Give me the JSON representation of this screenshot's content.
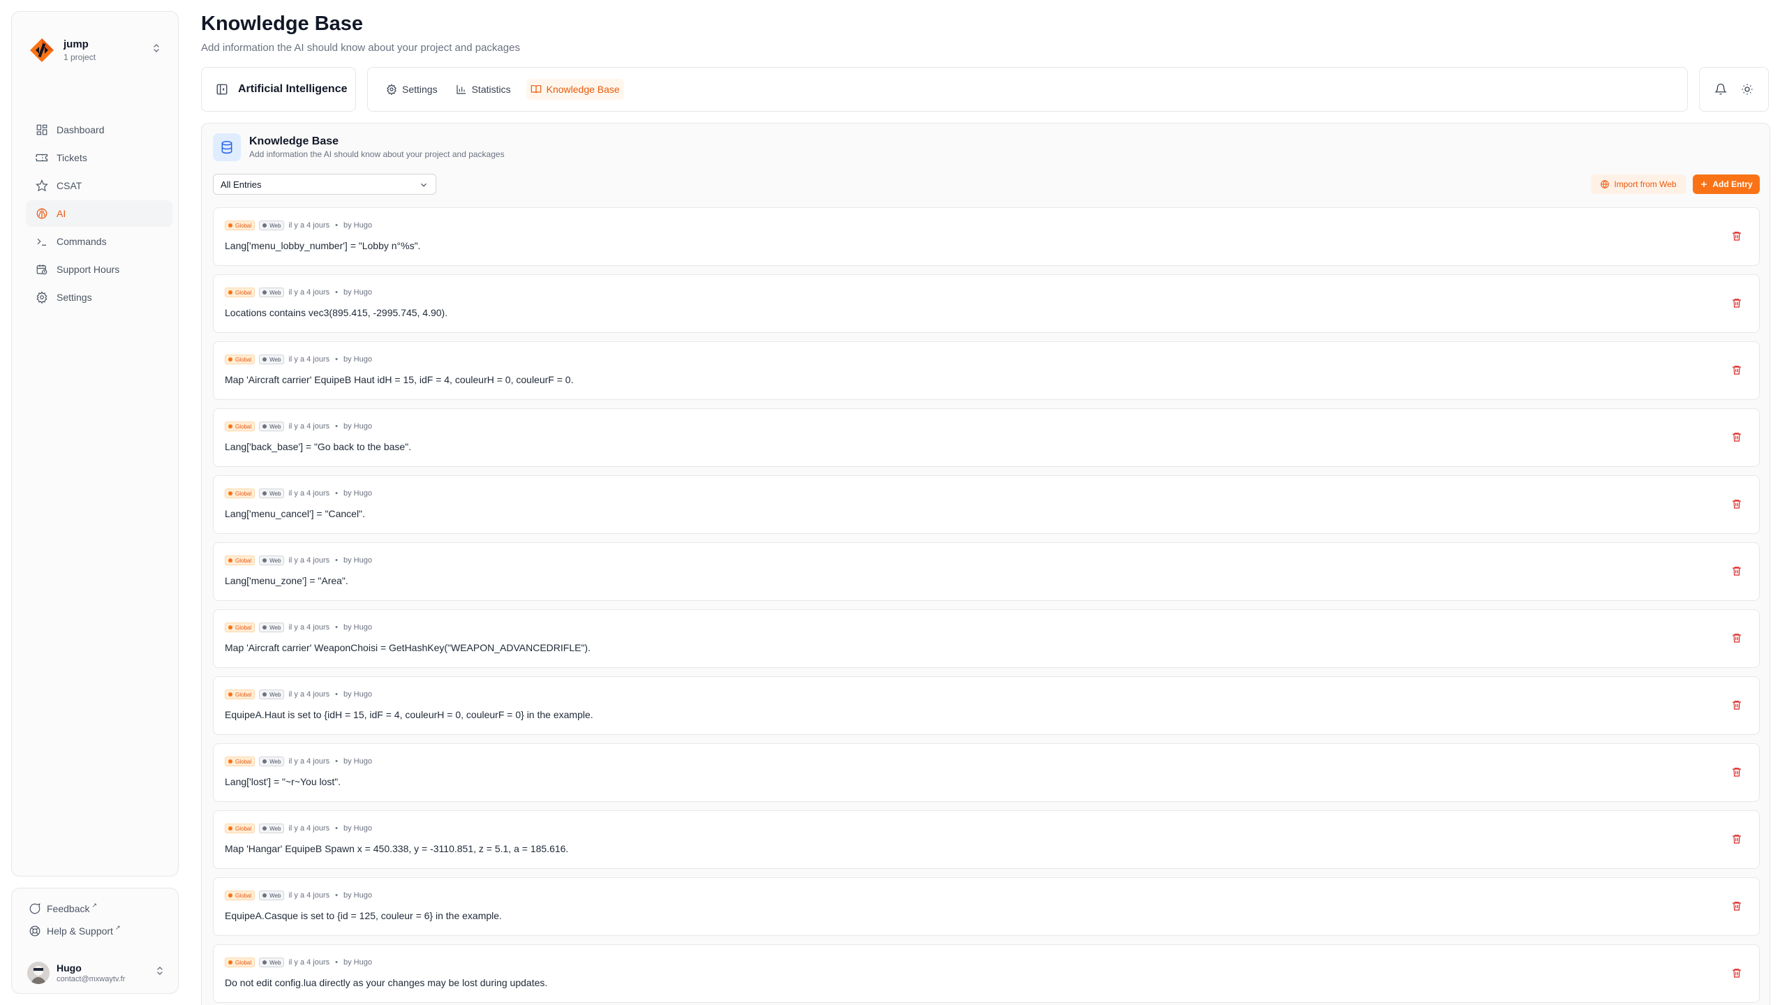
{
  "project": {
    "name": "jump",
    "sub": "1 project"
  },
  "nav": [
    {
      "label": "Dashboard",
      "icon": "dashboard-icon",
      "active": false
    },
    {
      "label": "Tickets",
      "icon": "ticket-icon",
      "active": false
    },
    {
      "label": "CSAT",
      "icon": "star-icon",
      "active": false
    },
    {
      "label": "AI",
      "icon": "brain-icon",
      "active": true
    },
    {
      "label": "Commands",
      "icon": "terminal-icon",
      "active": false
    },
    {
      "label": "Support Hours",
      "icon": "calendar-clock-icon",
      "active": false
    },
    {
      "label": "Settings",
      "icon": "gear-icon",
      "active": false
    }
  ],
  "footer": {
    "feedback": "Feedback",
    "help": "Help & Support",
    "ext_glyph": "↗"
  },
  "user": {
    "name": "Hugo",
    "email": "contact@mxwaytv.fr"
  },
  "page": {
    "title": "Knowledge Base",
    "description": "Add information the AI should know about your project and packages"
  },
  "section_label": "Artificial Intelligence",
  "tabs": [
    {
      "label": "Settings",
      "active": false
    },
    {
      "label": "Statistics",
      "active": false
    },
    {
      "label": "Knowledge Base",
      "active": true
    }
  ],
  "panel": {
    "title": "Knowledge Base",
    "subtitle": "Add information the AI should know about your project and packages",
    "filter_value": "All Entries",
    "import_label": "Import from Web",
    "add_label": "Add Entry"
  },
  "colors": {
    "accent": "#f97316",
    "accent_text": "#ea580c",
    "danger": "#dc2626"
  },
  "entry_meta": {
    "badge_global": "Global",
    "badge_web": "Web",
    "time": "il y a 4 jours",
    "separator": "•",
    "author": "by Hugo"
  },
  "entries": [
    "Lang['menu_lobby_number'] = \"Lobby n°%s\".",
    "Locations contains vec3(895.415, -2995.745, 4.90).",
    "Map 'Aircraft carrier' EquipeB Haut idH = 15, idF = 4, couleurH = 0, couleurF = 0.",
    "Lang['back_base'] = \"Go back to the base\".",
    "Lang['menu_cancel'] = \"Cancel\".",
    "Lang['menu_zone'] = \"Area\".",
    "Map 'Aircraft carrier' WeaponChoisi = GetHashKey(\"WEAPON_ADVANCEDRIFLE\").",
    "EquipeA.Haut is set to {idH = 15, idF = 4, couleurH = 0, couleurF = 0} in the example.",
    "Lang['lost'] = \"~r~You lost\".",
    "Map 'Hangar' EquipeB Spawn x = 450.338, y = -3110.851, z = 5.1, a = 185.616.",
    "EquipeA.Casque is set to {id = 125, couleur = 6} in the example.",
    "Do not edit config.lua directly as your changes may be lost during updates."
  ]
}
